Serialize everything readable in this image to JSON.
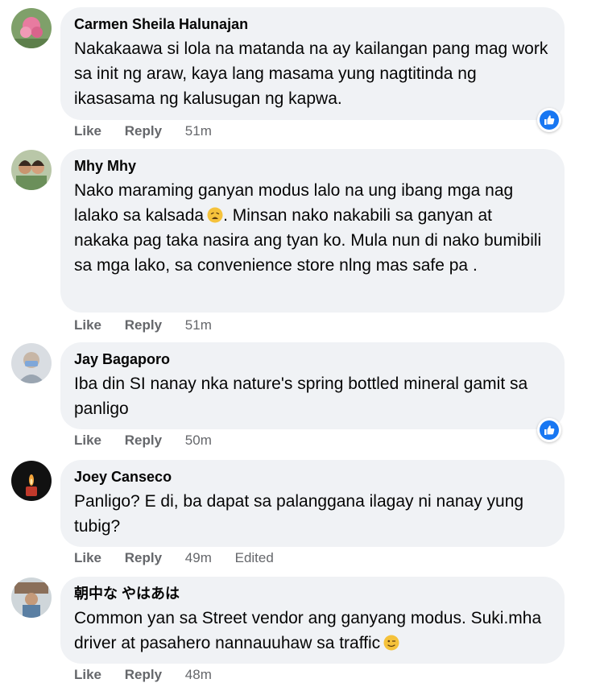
{
  "colors": {
    "bubble": "#f0f2f5",
    "meta": "#65676b",
    "like_blue": "#1877f2"
  },
  "comments": [
    {
      "author": "Carmen Sheila Halunajan",
      "text": "Nakakaawa si lola na matanda na ay kailangan pang mag work sa init ng araw, kaya lang masama yung nagtitinda ng ikasasama ng kalusugan ng kapwa.",
      "like": "Like",
      "reply": "Reply",
      "time": "51m",
      "reaction_icon": "like-reaction-icon"
    },
    {
      "author": "Mhy Mhy",
      "text_before_emoji": "Nako maraming ganyan modus lalo na ung ibang mga nag lalako sa kalsada",
      "emoji": "weary-face-emoji",
      "text_after_emoji": ". Minsan nako nakabili sa ganyan at nakaka pag taka nasira ang tyan ko. Mula nun di nako bumibili sa mga lako, sa convenience store nlng mas safe pa .",
      "like": "Like",
      "reply": "Reply",
      "time": "51m"
    },
    {
      "author": "Jay Bagaporo",
      "text": "Iba din SI nanay nka nature's spring bottled mineral gamit sa panligo",
      "like": "Like",
      "reply": "Reply",
      "time": "50m",
      "reaction_icon": "like-reaction-icon"
    },
    {
      "author": "Joey Canseco",
      "text": "Panligo? E di, ba dapat sa palanggana ilagay ni nanay yung tubig?",
      "like": "Like",
      "reply": "Reply",
      "time": "49m",
      "edited": "Edited"
    },
    {
      "author": "朝中な やはあは",
      "text_before_emoji": "Common yan sa Street vendor ang ganyang modus. Suki.mha driver at pasahero nannauuhaw sa traffic",
      "emoji": "winking-face-emoji",
      "like": "Like",
      "reply": "Reply",
      "time": "48m"
    }
  ]
}
